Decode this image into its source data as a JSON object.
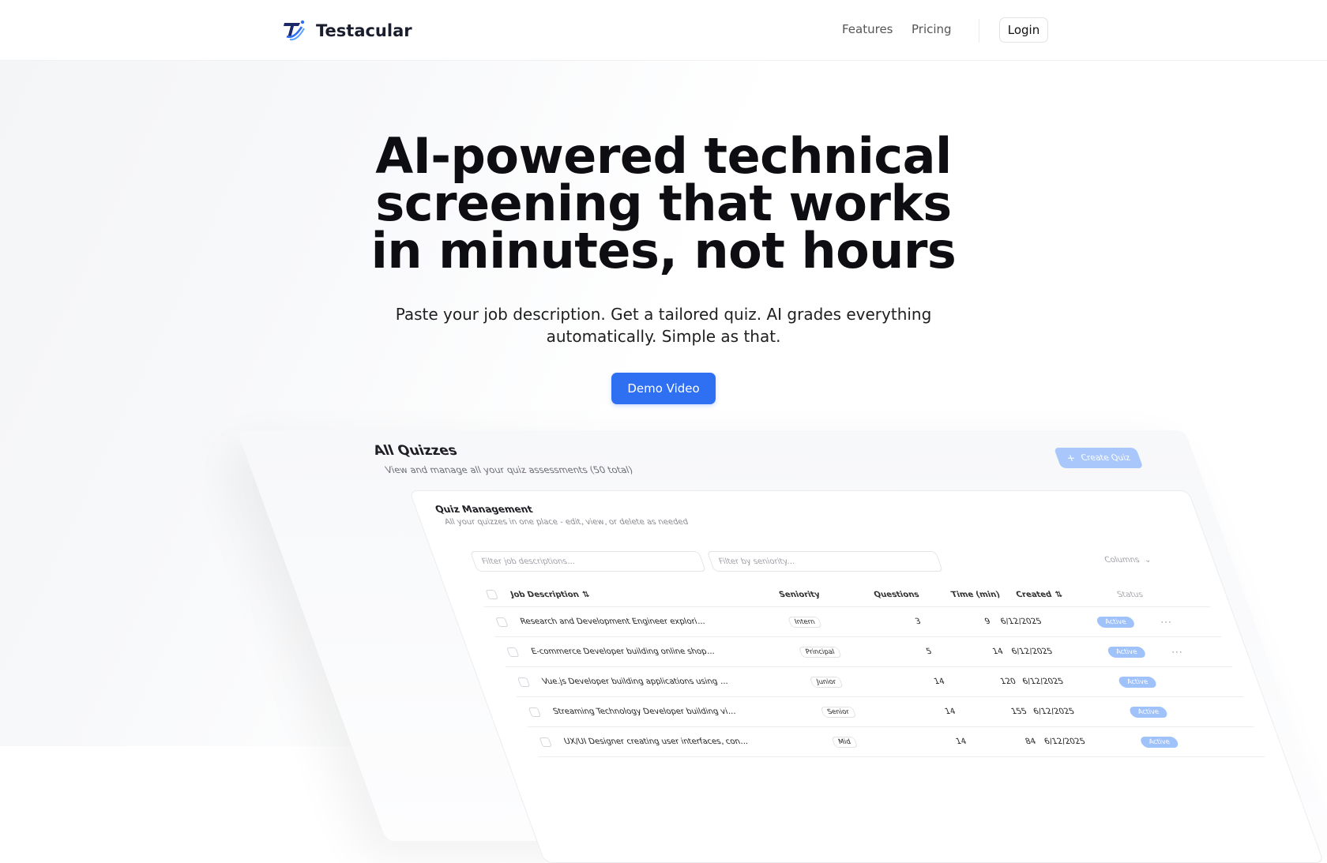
{
  "brand": {
    "name": "Testacular"
  },
  "nav": {
    "links": [
      {
        "label": "Features"
      },
      {
        "label": "Pricing"
      }
    ],
    "login_label": "Login"
  },
  "hero": {
    "headline_lines": [
      "AI-powered technical",
      "screening that works",
      "in minutes, not hours"
    ],
    "subheading_lines": [
      "Paste your job description. Get a tailored quiz. AI grades everything",
      "automatically. Simple as that."
    ],
    "cta_label": "Demo Video"
  },
  "preview": {
    "title": "All Quizzes",
    "subtitle": "View and manage all your quiz assessments (50 total)",
    "create_label": "Create Quiz",
    "card": {
      "title": "Quiz Management",
      "subtitle": "All your quizzes in one place - edit, view, or delete as needed",
      "filter_job_placeholder": "Filter job descriptions...",
      "filter_seniority_placeholder": "Filter by seniority...",
      "columns_label": "Columns",
      "headers": {
        "job": "Job Description",
        "seniority": "Seniority",
        "questions": "Questions",
        "time": "Time (min)",
        "created": "Created",
        "status": "Status"
      },
      "rows": [
        {
          "job": "Research and Development Engineer explori...",
          "seniority": "Intern",
          "questions": "3",
          "time": "9",
          "created": "6/12/2025",
          "status": "Active"
        },
        {
          "job": "E-commerce Developer building online shop...",
          "seniority": "Principal",
          "questions": "5",
          "time": "14",
          "created": "6/12/2025",
          "status": "Active"
        },
        {
          "job": "Vue.js Developer building applications using ...",
          "seniority": "Junior",
          "questions": "14",
          "time": "120",
          "created": "6/12/2025",
          "status": "Active"
        },
        {
          "job": "Streaming Technology Developer building vi...",
          "seniority": "Senior",
          "questions": "14",
          "time": "155",
          "created": "6/12/2025",
          "status": "Active"
        },
        {
          "job": "UX/UI Designer creating user interfaces, con...",
          "seniority": "Mid",
          "questions": "14",
          "time": "84",
          "created": "6/12/2025",
          "status": "Active"
        }
      ]
    }
  },
  "colors": {
    "accent": "#2f6ff2",
    "accent_light": "#9fc2fb",
    "text": "#0d0d12"
  }
}
